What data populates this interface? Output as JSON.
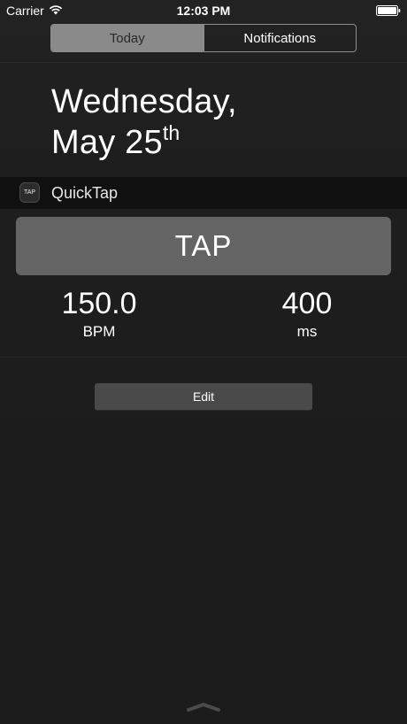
{
  "status_bar": {
    "carrier": "Carrier",
    "time": "12:03 PM",
    "wifi_icon": "wifi-icon",
    "battery_icon": "battery-icon"
  },
  "segments": [
    {
      "label": "Today",
      "selected": true
    },
    {
      "label": "Notifications",
      "selected": false
    }
  ],
  "date": {
    "weekday": "Wednesday,",
    "month_day": "May 25",
    "suffix": "th"
  },
  "widget": {
    "app_icon_text": "TAP",
    "title": "QuickTap",
    "tap_label": "TAP",
    "bpm_value": "150.0",
    "bpm_unit": "BPM",
    "ms_value": "400",
    "ms_unit": "ms"
  },
  "edit": {
    "label": "Edit"
  },
  "grabber_icon": "chevron-up-grabber-icon",
  "colors": {
    "background": "#1c1c1c",
    "tap_button": "#646464",
    "edit_button": "#4a4a4a",
    "selected_segment": "#8a8a8a"
  }
}
